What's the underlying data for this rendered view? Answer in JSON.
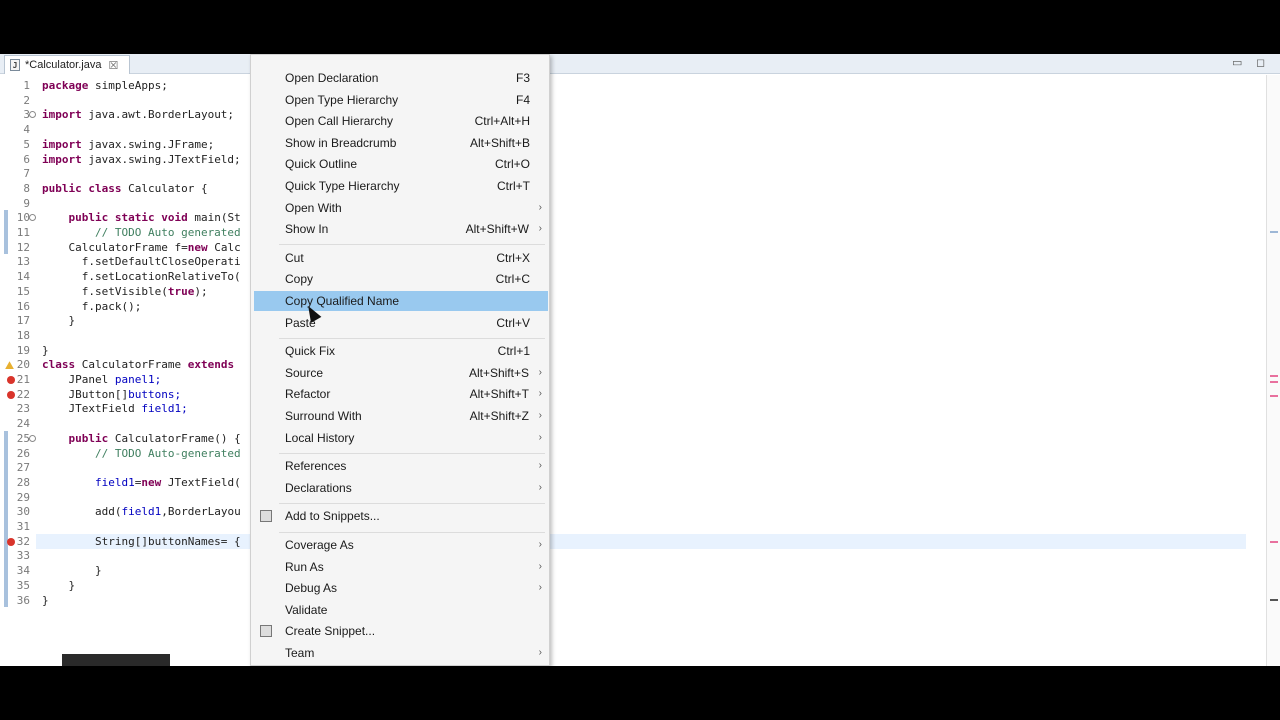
{
  "editor": {
    "tab_title": "*Calculator.java",
    "tab_close": "☒",
    "file_icon": "J",
    "minimize_glyph": "▭",
    "maximize_glyph": "◻",
    "lines": [
      {
        "n": "1",
        "code": [
          {
            "t": "package ",
            "c": "kw"
          },
          {
            "t": "simpleApps;",
            "c": ""
          }
        ]
      },
      {
        "n": "2",
        "code": []
      },
      {
        "n": "3",
        "code": [
          {
            "t": "import ",
            "c": "kw"
          },
          {
            "t": "java.awt.BorderLayout;",
            "c": ""
          }
        ]
      },
      {
        "n": "4",
        "code": []
      },
      {
        "n": "5",
        "code": [
          {
            "t": "import ",
            "c": "kw"
          },
          {
            "t": "javax.swing.JFrame;",
            "c": ""
          }
        ]
      },
      {
        "n": "6",
        "code": [
          {
            "t": "import ",
            "c": "kw"
          },
          {
            "t": "javax.swing.JTextField;",
            "c": ""
          }
        ]
      },
      {
        "n": "7",
        "code": []
      },
      {
        "n": "8",
        "code": [
          {
            "t": "public class ",
            "c": "kw"
          },
          {
            "t": "Calculator {",
            "c": ""
          }
        ]
      },
      {
        "n": "9",
        "code": []
      },
      {
        "n": "10",
        "code": [
          {
            "t": "    public static void ",
            "c": "kw"
          },
          {
            "t": "main(St",
            "c": ""
          }
        ]
      },
      {
        "n": "11",
        "code": [
          {
            "t": "        // TODO Auto generated",
            "c": "cm"
          }
        ]
      },
      {
        "n": "12",
        "code": [
          {
            "t": "    CalculatorFrame f=",
            "c": ""
          },
          {
            "t": "new ",
            "c": "kw"
          },
          {
            "t": "Calc",
            "c": ""
          }
        ]
      },
      {
        "n": "13",
        "code": [
          {
            "t": "      f.setDefaultCloseOperati",
            "c": ""
          }
        ]
      },
      {
        "n": "14",
        "code": [
          {
            "t": "      f.setLocationRelativeTo(",
            "c": ""
          }
        ]
      },
      {
        "n": "15",
        "code": [
          {
            "t": "      f.setVisible(",
            "c": ""
          },
          {
            "t": "true",
            "c": "kw"
          },
          {
            "t": ");",
            "c": ""
          }
        ]
      },
      {
        "n": "16",
        "code": [
          {
            "t": "      f.pack();",
            "c": ""
          }
        ]
      },
      {
        "n": "17",
        "code": [
          {
            "t": "    }",
            "c": ""
          }
        ]
      },
      {
        "n": "18",
        "code": []
      },
      {
        "n": "19",
        "code": [
          {
            "t": "}",
            "c": ""
          }
        ]
      },
      {
        "n": "20",
        "code": [
          {
            "t": "class ",
            "c": "kw"
          },
          {
            "t": "CalculatorFrame ",
            "c": ""
          },
          {
            "t": "extends",
            "c": "kw"
          }
        ]
      },
      {
        "n": "21",
        "code": [
          {
            "t": "    JPanel ",
            "c": ""
          },
          {
            "t": "panel1;",
            "c": "fld"
          }
        ]
      },
      {
        "n": "22",
        "code": [
          {
            "t": "    JButton[]",
            "c": ""
          },
          {
            "t": "buttons;",
            "c": "fld"
          }
        ]
      },
      {
        "n": "23",
        "code": [
          {
            "t": "    JTextField ",
            "c": ""
          },
          {
            "t": "field1;",
            "c": "fld"
          }
        ]
      },
      {
        "n": "24",
        "code": []
      },
      {
        "n": "25",
        "code": [
          {
            "t": "    public ",
            "c": "kw"
          },
          {
            "t": "CalculatorFrame() {",
            "c": ""
          }
        ]
      },
      {
        "n": "26",
        "code": [
          {
            "t": "        // TODO Auto-generated",
            "c": "cm"
          }
        ]
      },
      {
        "n": "27",
        "code": []
      },
      {
        "n": "28",
        "code": [
          {
            "t": "        field1",
            "c": "fld"
          },
          {
            "t": "=",
            "c": ""
          },
          {
            "t": "new ",
            "c": "kw"
          },
          {
            "t": "JTextField(",
            "c": ""
          }
        ]
      },
      {
        "n": "29",
        "code": []
      },
      {
        "n": "30",
        "code": [
          {
            "t": "        add(",
            "c": ""
          },
          {
            "t": "field1",
            "c": "fld"
          },
          {
            "t": ",BorderLayou",
            "c": ""
          }
        ]
      },
      {
        "n": "31",
        "code": []
      },
      {
        "n": "32",
        "code": [
          {
            "t": "        String[]buttonNames= {",
            "c": ""
          }
        ]
      },
      {
        "n": "33",
        "code": []
      },
      {
        "n": "34",
        "code": [
          {
            "t": "        }",
            "c": ""
          }
        ]
      },
      {
        "n": "35",
        "code": [
          {
            "t": "    }",
            "c": ""
          }
        ]
      },
      {
        "n": "36",
        "code": [
          {
            "t": "}",
            "c": ""
          }
        ]
      }
    ]
  },
  "context_menu": {
    "items": [
      {
        "label": "Open Declaration",
        "accel": "F3"
      },
      {
        "label": "Open Type Hierarchy",
        "accel": "F4"
      },
      {
        "label": "Open Call Hierarchy",
        "accel": "Ctrl+Alt+H"
      },
      {
        "label": "Show in Breadcrumb",
        "accel": "Alt+Shift+B"
      },
      {
        "label": "Quick Outline",
        "accel": "Ctrl+O"
      },
      {
        "label": "Quick Type Hierarchy",
        "accel": "Ctrl+T"
      },
      {
        "label": "Open With",
        "accel": "",
        "submenu": true
      },
      {
        "label": "Show In",
        "accel": "Alt+Shift+W",
        "submenu": true
      },
      {
        "sep": true
      },
      {
        "label": "Cut",
        "accel": "Ctrl+X"
      },
      {
        "label": "Copy",
        "accel": "Ctrl+C"
      },
      {
        "label": "Copy Qualified Name",
        "accel": "",
        "selected": true
      },
      {
        "label": "Paste",
        "accel": "Ctrl+V"
      },
      {
        "sep": true
      },
      {
        "label": "Quick Fix",
        "accel": "Ctrl+1"
      },
      {
        "label": "Source",
        "accel": "Alt+Shift+S",
        "submenu": true
      },
      {
        "label": "Refactor",
        "accel": "Alt+Shift+T",
        "submenu": true
      },
      {
        "label": "Surround With",
        "accel": "Alt+Shift+Z",
        "submenu": true
      },
      {
        "label": "Local History",
        "accel": "",
        "submenu": true
      },
      {
        "sep": true
      },
      {
        "label": "References",
        "accel": "",
        "submenu": true
      },
      {
        "label": "Declarations",
        "accel": "",
        "submenu": true
      },
      {
        "sep": true
      },
      {
        "label": "Add to Snippets...",
        "accel": "",
        "icon": "snippet-icon"
      },
      {
        "sep": true
      },
      {
        "label": "Coverage As",
        "accel": "",
        "submenu": true
      },
      {
        "label": "Run As",
        "accel": "",
        "submenu": true
      },
      {
        "label": "Debug As",
        "accel": "",
        "submenu": true
      },
      {
        "label": "Validate",
        "accel": ""
      },
      {
        "label": "Create Snippet...",
        "accel": "",
        "icon": "create-snippet-icon"
      },
      {
        "label": "Team",
        "accel": "",
        "submenu": true
      }
    ],
    "submenu_arrow": "›"
  },
  "colors": {
    "selection": "#99c9ef",
    "keyword": "#7f0055",
    "comment": "#3f7f5f",
    "field": "#0000c0"
  }
}
